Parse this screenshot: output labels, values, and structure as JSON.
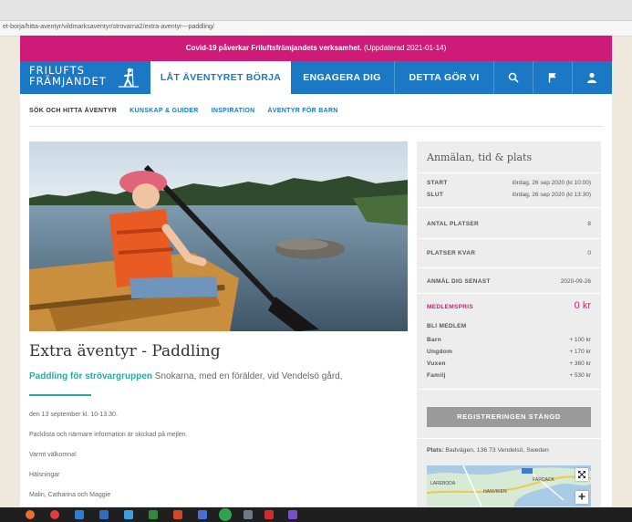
{
  "browser": {
    "url": "et-borja/hitta-aventyr/vildmarksaventyr/strovarna2/extra-aventyr---paddling/"
  },
  "banner": {
    "bold": "Covid-19 påverkar Friluftsfrämjandets verksamhet.",
    "updated": "(Uppdaterad 2021-01-14)"
  },
  "logo": {
    "line1": "FRILUFTS",
    "line2": "FRÄMJANDET"
  },
  "nav": {
    "tab1": "LÅT ÄVENTYRET BÖRJA",
    "tab2": "ENGAGERA DIG",
    "tab3": "DETTA GÖR VI"
  },
  "subnav": {
    "item1": "SÖK OCH HITTA ÄVENTYR",
    "item2": "KUNSKAP & GUIDER",
    "item3": "INSPIRATION",
    "item4": "ÄVENTYR FÖR BARN"
  },
  "article": {
    "title": "Extra äventyr - Paddling",
    "lead_green": "Paddling för strövargruppen",
    "lead_rest": " Snokarna, med en förälder, vid Vendelsö gård,",
    "p1": "den 13 september kl. 10-13.30.",
    "p2": "Packlista och närmare information är skickad på mejlen.",
    "p3": "Varmt välkomna!",
    "p4": "Hälsningar",
    "p5": "Malin, Catharina och Maggie"
  },
  "sidebar": {
    "title": "Anmälan, tid & plats",
    "start_label": "START",
    "start_value": "lördag, 26 sep 2020 (kl 10:00)",
    "end_label": "SLUT",
    "end_value": "lördag, 26 sep 2020 (kl 13:30)",
    "seats_label": "ANTAL PLATSER",
    "seats_value": "8",
    "left_label": "PLATSER KVAR",
    "left_value": "0",
    "deadline_label": "ANMÄL DIG SENAST",
    "deadline_value": "2020-09-26",
    "member_price_label": "MEDLEMSPRIS",
    "member_price_value": "0 kr",
    "membership_title": "BLI MEDLEM",
    "membership": [
      {
        "label": "Barn",
        "price": "+ 100 kr"
      },
      {
        "label": "Ungdom",
        "price": "+ 170 kr"
      },
      {
        "label": "Vuxen",
        "price": "+ 360 kr"
      },
      {
        "label": "Familj",
        "price": "+ 530 kr"
      }
    ],
    "register_button": "REGISTRERINGEN STÄNGD",
    "place_label": "Plats:",
    "place_value": " Badvägen, 136 73 Vendelsö, Sweden",
    "map_label1": "LAREBODA",
    "map_label2": "FÄRDACK",
    "map_label3": "HANVIKEN"
  },
  "colors": {
    "brand_blue": "#1b78c4",
    "banner_pink": "#cf1b78",
    "accent_teal": "#2aa8a0",
    "sidebar_bg": "#ededed"
  }
}
